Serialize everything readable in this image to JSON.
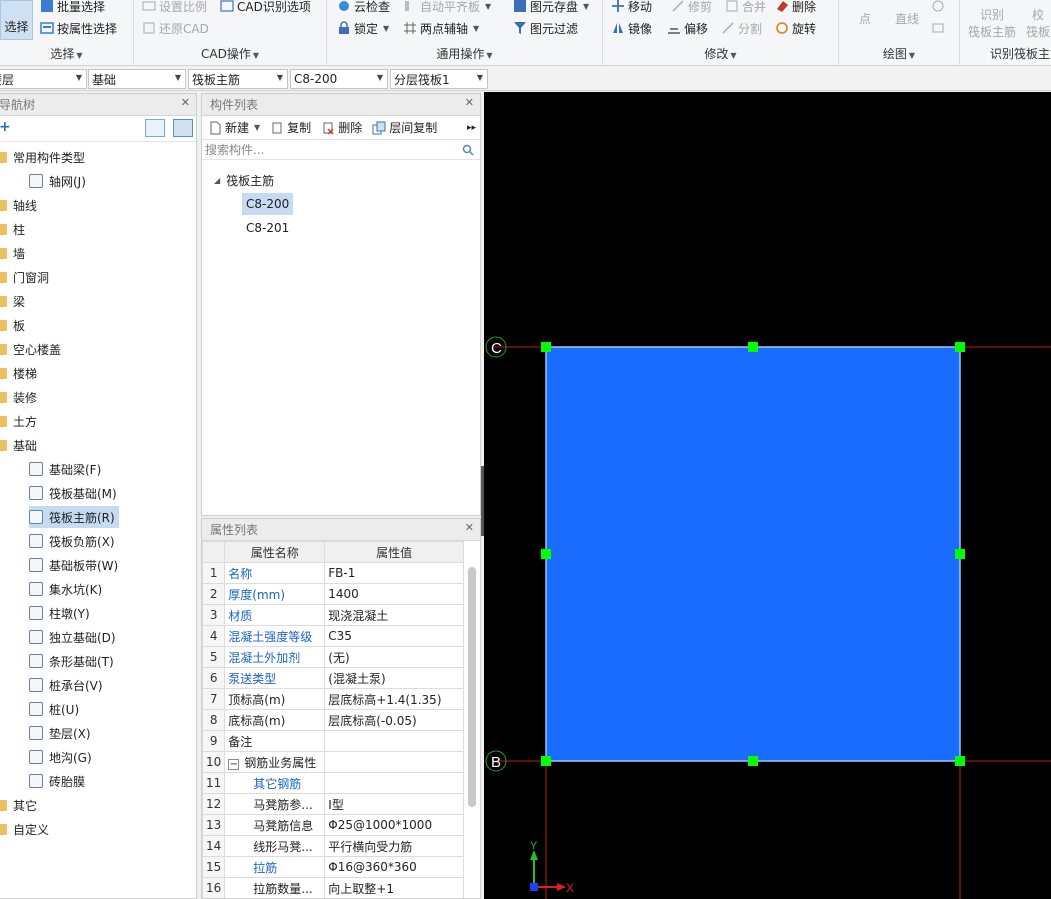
{
  "ribbon": {
    "groups": [
      {
        "label": "选择",
        "buttons": [
          "选择",
          "批量选择",
          "按属性选择"
        ]
      },
      {
        "label": "CAD操作",
        "buttons": [
          "设置比例",
          "CAD识别选项",
          "还原CAD"
        ]
      },
      {
        "label": "通用操作",
        "buttons": [
          "云检查",
          "自动平齐板",
          "图元存盘",
          "锁定",
          "两点辅轴",
          "图元过滤"
        ]
      },
      {
        "label": "修改",
        "buttons": [
          "移动",
          "修剪",
          "合并",
          "删除",
          "镜像",
          "偏移",
          "分割",
          "旋转"
        ]
      },
      {
        "label": "绘图",
        "buttons": [
          "点",
          "直线"
        ]
      },
      {
        "label": "识别筏板主筋",
        "buttons": [
          "识别",
          "筏板主筋",
          "校",
          "筏板"
        ]
      }
    ]
  },
  "combos": [
    "楼层",
    "基础",
    "筏板主筋",
    "C8-200",
    "分层筏板1"
  ],
  "nav": {
    "title": "导航树",
    "items": [
      {
        "label": "常用构件类型",
        "type": "folder"
      },
      {
        "label": "轴网(J)",
        "type": "child",
        "icon": "grid-icon"
      },
      {
        "label": "轴线",
        "type": "folder"
      },
      {
        "label": "柱",
        "type": "folder"
      },
      {
        "label": "墙",
        "type": "folder"
      },
      {
        "label": "门窗洞",
        "type": "folder"
      },
      {
        "label": "梁",
        "type": "folder"
      },
      {
        "label": "板",
        "type": "folder"
      },
      {
        "label": "空心楼盖",
        "type": "folder"
      },
      {
        "label": "楼梯",
        "type": "folder"
      },
      {
        "label": "装修",
        "type": "folder"
      },
      {
        "label": "土方",
        "type": "folder"
      },
      {
        "label": "基础",
        "type": "folder"
      },
      {
        "label": "基础梁(F)",
        "type": "child",
        "icon": "beam-icon"
      },
      {
        "label": "筏板基础(M)",
        "type": "child",
        "icon": "raft-icon"
      },
      {
        "label": "筏板主筋(R)",
        "type": "child",
        "icon": "rebar-icon",
        "selected": true
      },
      {
        "label": "筏板负筋(X)",
        "type": "child",
        "icon": "neg-rebar-icon"
      },
      {
        "label": "基础板带(W)",
        "type": "child",
        "icon": "strip-icon"
      },
      {
        "label": "集水坑(K)",
        "type": "child",
        "icon": "pit-icon"
      },
      {
        "label": "柱墩(Y)",
        "type": "child",
        "icon": "pier-icon"
      },
      {
        "label": "独立基础(D)",
        "type": "child",
        "icon": "footing-icon"
      },
      {
        "label": "条形基础(T)",
        "type": "child",
        "icon": "strip-footing-icon"
      },
      {
        "label": "桩承台(V)",
        "type": "child",
        "icon": "pile-cap-icon"
      },
      {
        "label": "桩(U)",
        "type": "child",
        "icon": "pile-icon"
      },
      {
        "label": "垫层(X)",
        "type": "child",
        "icon": "cushion-icon"
      },
      {
        "label": "地沟(G)",
        "type": "child",
        "icon": "trench-icon"
      },
      {
        "label": "砖胎膜",
        "type": "child",
        "icon": "brick-icon"
      },
      {
        "label": "其它",
        "type": "folder"
      },
      {
        "label": "自定义",
        "type": "folder"
      }
    ]
  },
  "components": {
    "title": "构件列表",
    "new": "新建",
    "copy": "复制",
    "delete": "删除",
    "floor_copy": "层间复制",
    "search_placeholder": "搜索构件...",
    "root": "筏板主筋",
    "items": [
      "C8-200",
      "C8-201"
    ]
  },
  "properties": {
    "title": "属性列表",
    "col_name": "属性名称",
    "col_value": "属性值",
    "rows": [
      {
        "n": "1",
        "name": "名称",
        "value": "FB-1",
        "blue": true
      },
      {
        "n": "2",
        "name": "厚度(mm)",
        "value": "1400",
        "blue": true
      },
      {
        "n": "3",
        "name": "材质",
        "value": "现浇混凝土",
        "blue": true
      },
      {
        "n": "4",
        "name": "混凝土强度等级",
        "value": "C35",
        "blue": true
      },
      {
        "n": "5",
        "name": "混凝土外加剂",
        "value": "(无)",
        "blue": true
      },
      {
        "n": "6",
        "name": "泵送类型",
        "value": "(混凝土泵)",
        "blue": true
      },
      {
        "n": "7",
        "name": "顶标高(m)",
        "value": "层底标高+1.4(1.35)",
        "blue": false
      },
      {
        "n": "8",
        "name": "底标高(m)",
        "value": "层底标高(-0.05)",
        "blue": false
      },
      {
        "n": "9",
        "name": "备注",
        "value": "",
        "blue": false
      },
      {
        "n": "10",
        "name": "钢筋业务属性",
        "value": "",
        "blue": false,
        "group": true
      },
      {
        "n": "11",
        "name": "其它钢筋",
        "value": "",
        "blue": true,
        "indent": true
      },
      {
        "n": "12",
        "name": "马凳筋参...",
        "value": "Ⅰ型",
        "blue": false,
        "indent": true
      },
      {
        "n": "13",
        "name": "马凳筋信息",
        "value": "Φ25@1000*1000",
        "blue": false,
        "indent": true
      },
      {
        "n": "14",
        "name": "线形马凳...",
        "value": "平行横向受力筋",
        "blue": false,
        "indent": true
      },
      {
        "n": "15",
        "name": "拉筋",
        "value": "Φ16@360*360",
        "blue": true,
        "indent": true
      },
      {
        "n": "16",
        "name": "拉筋数量...",
        "value": "向上取整+1",
        "blue": false,
        "indent": true
      }
    ]
  },
  "canvas": {
    "axis_c": "C",
    "axis_b": "B",
    "coord_x": "X",
    "coord_y": "Y",
    "slab_color": "#1a6cff",
    "grip_color": "#00ff00"
  }
}
